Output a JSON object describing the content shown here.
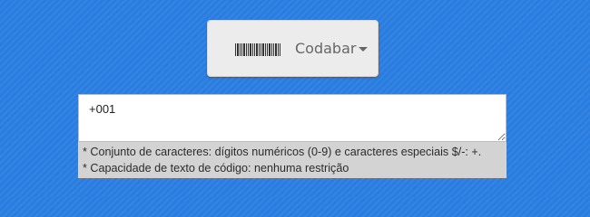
{
  "barcode_type": {
    "icon": "barcode-icon",
    "selected_label": "Codabar",
    "dropdown_icon": "caret-down-icon"
  },
  "code_input": {
    "value": "+001"
  },
  "info": {
    "charset_line": "* Conjunto de caracteres: dígitos numéricos (0-9) e caracteres especiais $/-: +.",
    "capacity_line": "* Capacidade de texto de código: nenhuma restrição"
  },
  "colors": {
    "background": "#2a7de0",
    "select_bg": "#ececec",
    "info_bg": "#d3d3d3"
  }
}
